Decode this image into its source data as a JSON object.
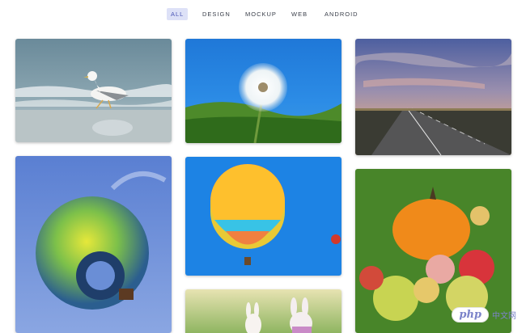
{
  "filters": [
    {
      "label": "ALL",
      "active": true
    },
    {
      "label": "DESIGN",
      "active": false
    },
    {
      "label": "MOCKUP",
      "active": false
    },
    {
      "label": "WEB",
      "active": false
    },
    {
      "label": "ANDROID",
      "active": false
    }
  ],
  "gallery": {
    "items": [
      {
        "subject": "seagull-on-beach"
      },
      {
        "subject": "dandelion"
      },
      {
        "subject": "road-at-sunset"
      },
      {
        "subject": "hot-air-balloon-green-yellow"
      },
      {
        "subject": "hot-air-balloon-rainbow"
      },
      {
        "subject": "pumpkin-and-apples"
      },
      {
        "subject": "easter-bunnies"
      }
    ]
  },
  "watermark": {
    "text": "php",
    "suffix": "中文网"
  }
}
